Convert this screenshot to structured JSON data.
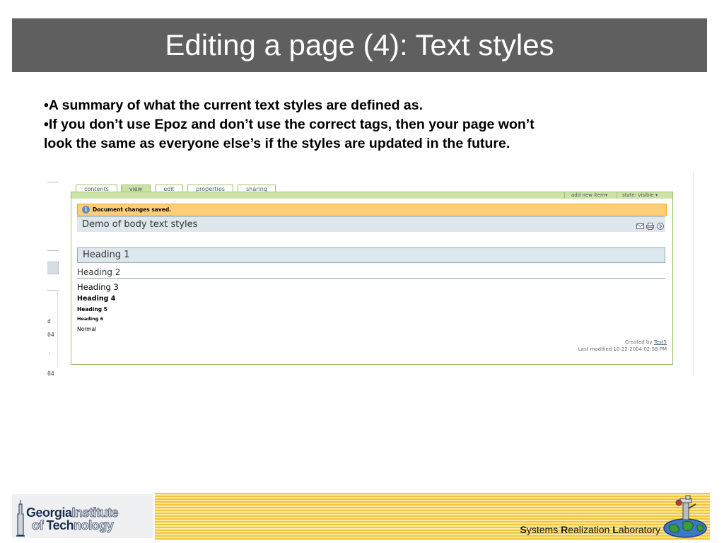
{
  "slide": {
    "title": "Editing a page (4): Text styles",
    "bullets": [
      "•A summary of what the current text styles are defined as.",
      "•If you don’t use Epoz and don’t use the correct tags, then your page won’t look the same as everyone else’s if the styles are updated in the future."
    ]
  },
  "screenshot": {
    "tabs": [
      {
        "label": "contents",
        "active": false
      },
      {
        "label": "view",
        "active": true
      },
      {
        "label": "edit",
        "active": false
      },
      {
        "label": "properties",
        "active": false
      },
      {
        "label": "sharing",
        "active": false
      }
    ],
    "actions": {
      "add_new_item": "add new item▾",
      "state": "state: visible ▾"
    },
    "message": "Document changes saved.",
    "message_icon": "info-icon",
    "doc_title": "Demo of body text styles",
    "doc_icons": [
      "mail-icon",
      "print-icon",
      "next-icon"
    ],
    "headings": {
      "h1": "Heading 1",
      "h2": "Heading 2",
      "h3": "Heading 3",
      "h4": "Heading 4",
      "h5": "Heading 5",
      "h6": "Heading 6",
      "normal": "Normal"
    },
    "byline": {
      "created_by_prefix": "Created by ",
      "author": "Test5",
      "last_modified": "Last modified 10-22-2004 02:58 PM"
    },
    "left_strip_glyphs": [
      "d",
      "04",
      "·",
      "04"
    ]
  },
  "footer": {
    "gt_logo": {
      "line1_dark": "Georgia",
      "line1_light": "Institute",
      "line2_light_prefix": "of ",
      "line2_dark": "Tech",
      "line2_light": "nology"
    },
    "lab": {
      "s": "S",
      "ystems": "ystems ",
      "r": "R",
      "ealization": "ealization ",
      "l": "L",
      "aboratory": "aboratory"
    },
    "colors": {
      "stripe_dark": "#f4c43a",
      "stripe_light": "#fbe9a6",
      "title_bar": "#5f5f5f",
      "plone_green": "#cde2a7",
      "plone_border": "#9bc36b",
      "message_bg": "#ffce7b"
    }
  }
}
